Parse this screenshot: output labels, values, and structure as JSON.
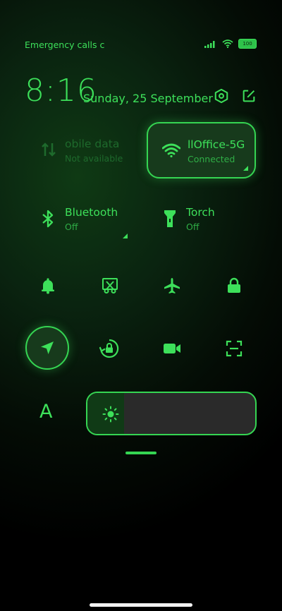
{
  "status_bar": {
    "carrier_text": "Emergency calls c",
    "battery_level": "100"
  },
  "header": {
    "time": "8:16",
    "date": "Sunday, 25 September"
  },
  "tiles": {
    "mobile_data": {
      "label": "obile data",
      "status": "Not available"
    },
    "wifi": {
      "label": "llOffice-5G",
      "status": "Connected"
    },
    "bluetooth": {
      "label": "Bluetooth",
      "status": "Off"
    },
    "torch": {
      "label": "Torch",
      "status": "Off"
    }
  },
  "toggles": {
    "row1": [
      "bell-icon",
      "screenshot-icon",
      "airplane-icon",
      "lock-icon"
    ],
    "row2": [
      "location-icon",
      "rotation-lock-icon",
      "video-camera-icon",
      "scan-icon"
    ]
  },
  "font_size_label": "A",
  "brightness": {
    "level": 0.22
  },
  "colors": {
    "accent": "#3de05a",
    "dim": "#1e6a2c",
    "tile_bg": "#173a1c"
  }
}
